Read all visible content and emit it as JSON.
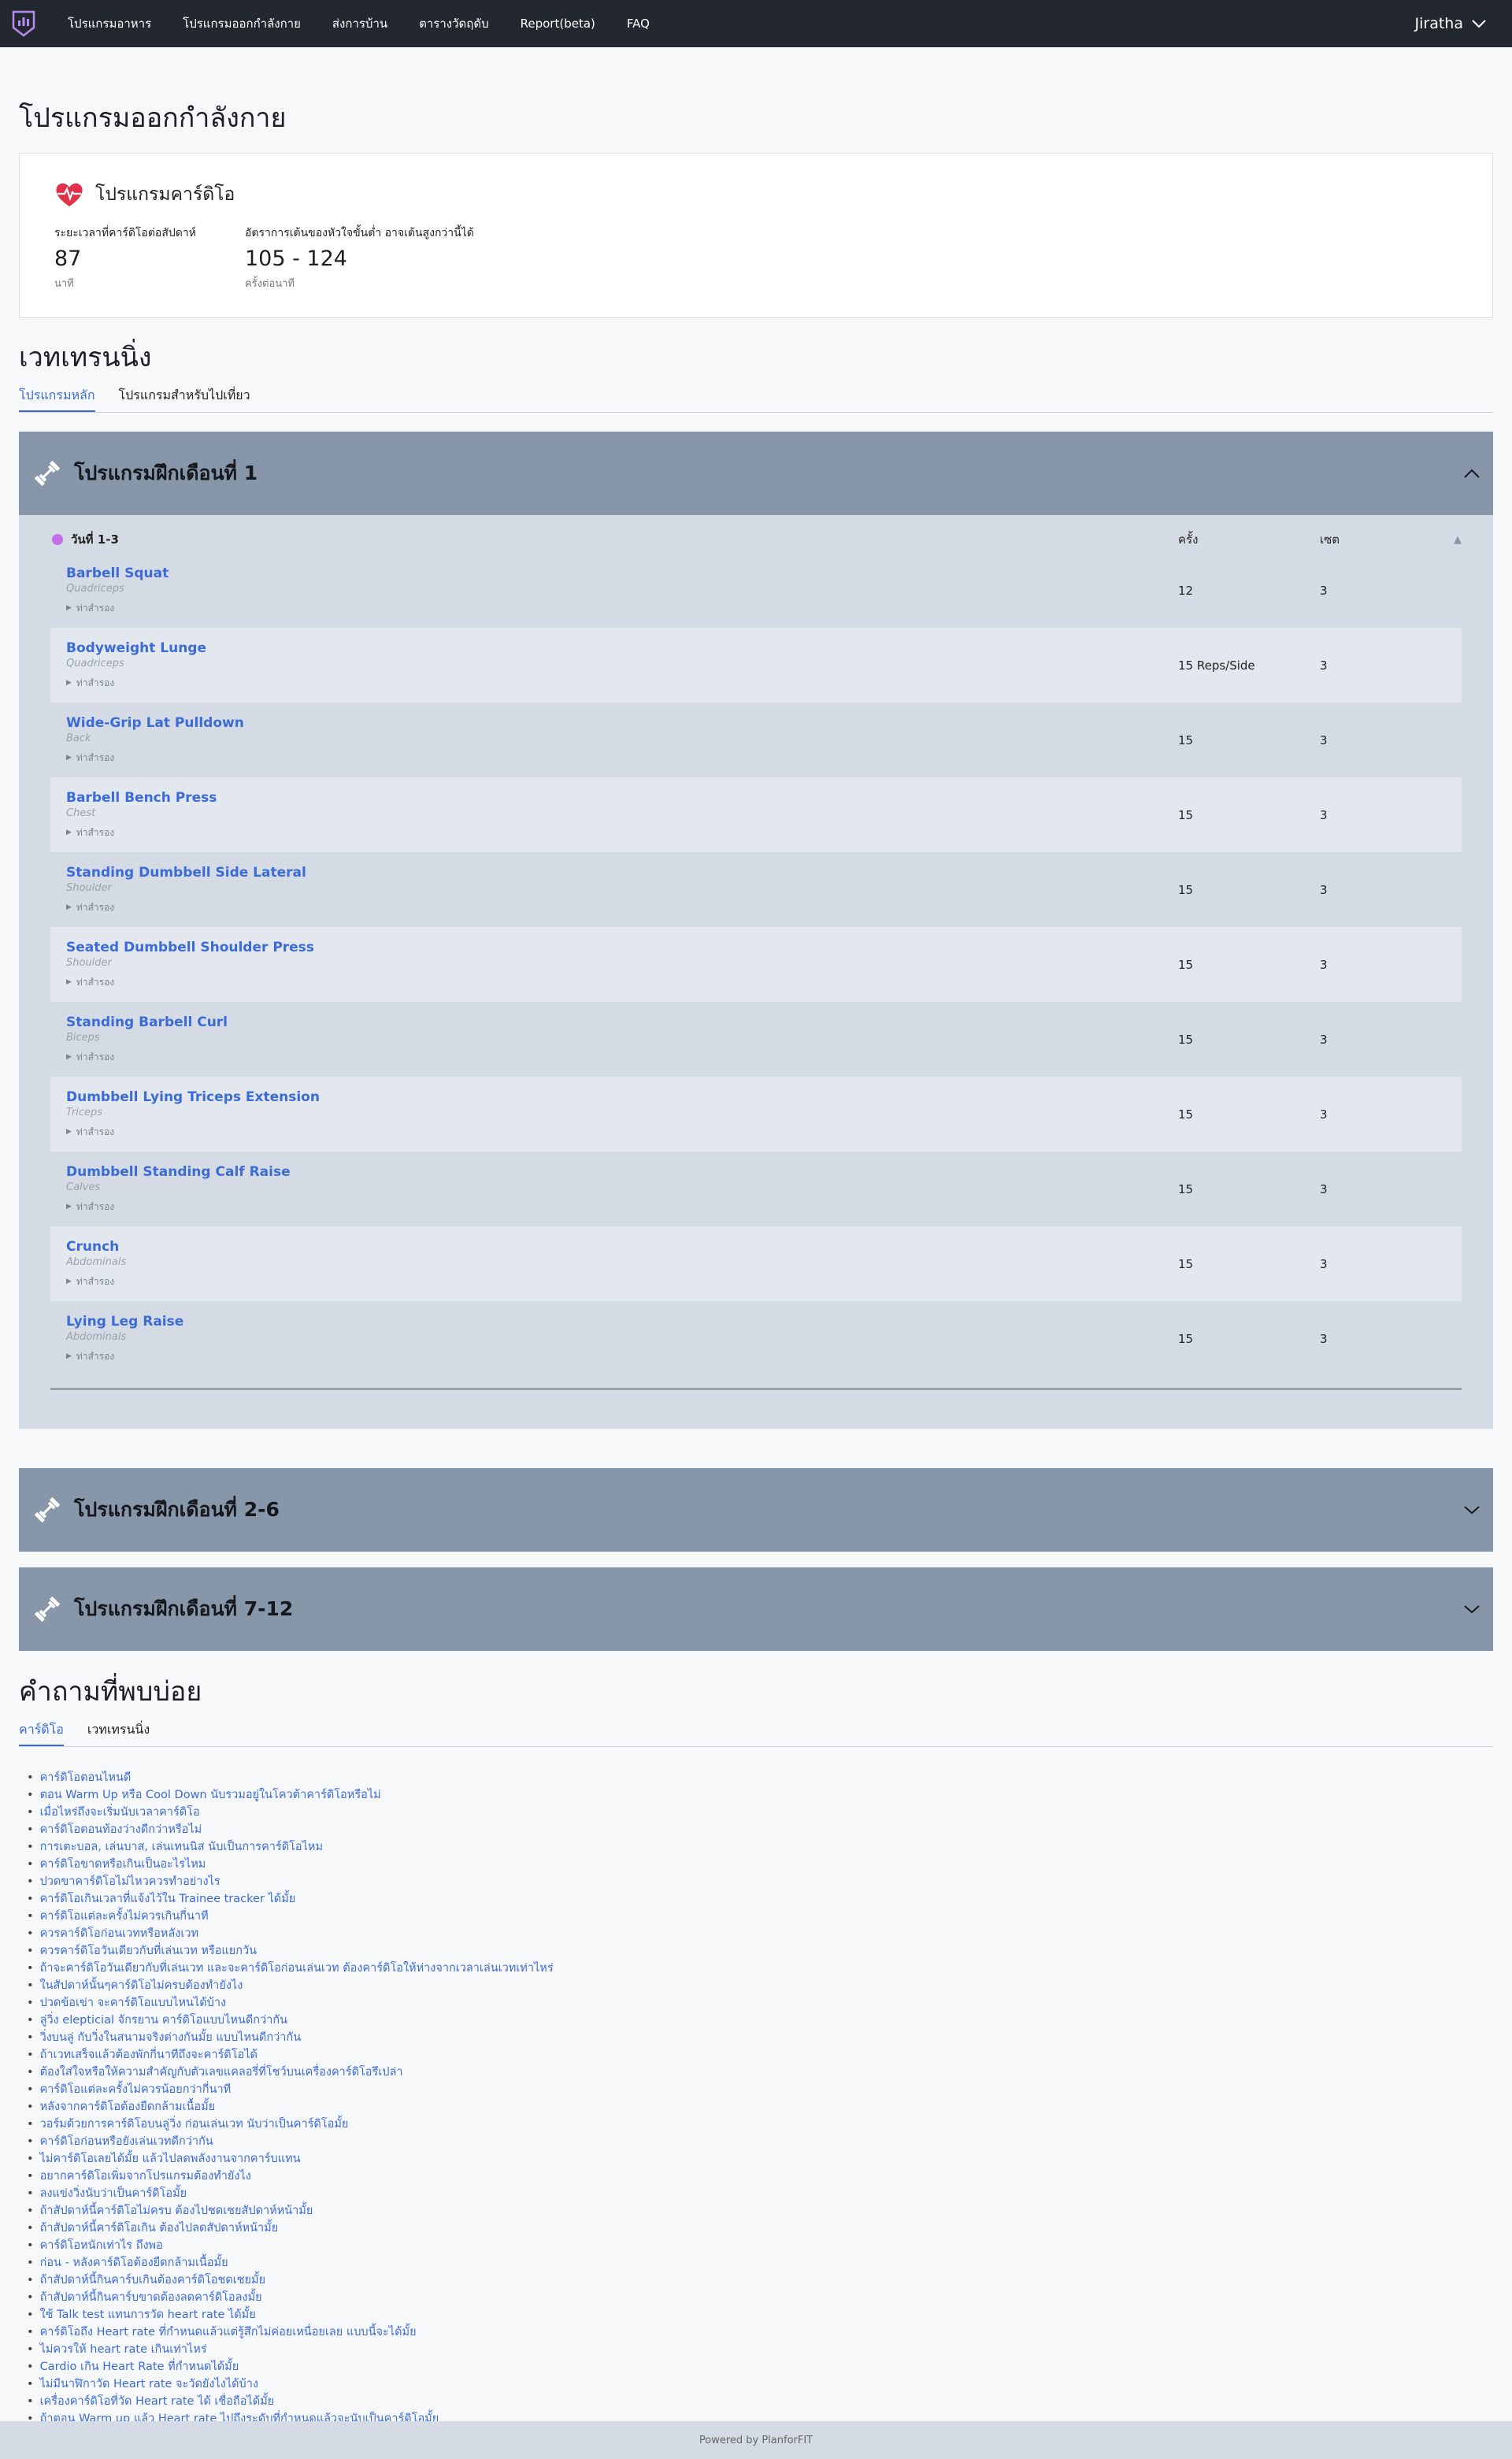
{
  "nav": {
    "links": [
      "โปรแกรมอาหาร",
      "โปรแกรมออกกำลังกาย",
      "ส่งการบ้าน",
      "ตารางวัดฤดับ",
      "Report(beta)",
      "FAQ"
    ],
    "user": "Jiratha"
  },
  "page": {
    "title": "โปรแกรมออกกำลังกาย"
  },
  "cardio": {
    "title": "โปรแกรมคาร์ดิโอ",
    "stat1_label": "ระยะเวลาที่คาร์ดิโอต่อสัปดาห์",
    "stat1_value": "87",
    "stat1_unit": "นาที",
    "stat2_label": "อัตราการเต้นของหัวใจขั้นต่ำ อาจเต้นสูงกว่านี้ได้",
    "stat2_value": "105 - 124",
    "stat2_unit": "ครั้งต่อนาที"
  },
  "weight": {
    "title": "เวทเทรนนิ่ง",
    "tabs": [
      "โปรแกรมหลัก",
      "โปรแกรมสำหรับไปเที่ยว"
    ],
    "month1_title": "โปรแกรมฝึกเดือนที่ 1",
    "day_label": "วันที่ 1-3",
    "col_reps": "ครั้ง",
    "col_sets": "เซต",
    "alt_label": "ท่าสำรอง",
    "exercises": [
      {
        "name": "Barbell Squat",
        "muscle": "Quadriceps",
        "reps": "12",
        "sets": "3"
      },
      {
        "name": "Bodyweight Lunge",
        "muscle": "Quadriceps",
        "reps": "15 Reps/Side",
        "sets": "3"
      },
      {
        "name": "Wide-Grip Lat Pulldown",
        "muscle": "Back",
        "reps": "15",
        "sets": "3"
      },
      {
        "name": "Barbell Bench Press",
        "muscle": "Chest",
        "reps": "15",
        "sets": "3"
      },
      {
        "name": "Standing Dumbbell Side Lateral",
        "muscle": "Shoulder",
        "reps": "15",
        "sets": "3"
      },
      {
        "name": "Seated Dumbbell Shoulder Press",
        "muscle": "Shoulder",
        "reps": "15",
        "sets": "3"
      },
      {
        "name": "Standing Barbell Curl",
        "muscle": "Biceps",
        "reps": "15",
        "sets": "3"
      },
      {
        "name": "Dumbbell Lying Triceps Extension",
        "muscle": "Triceps",
        "reps": "15",
        "sets": "3"
      },
      {
        "name": "Dumbbell Standing Calf Raise",
        "muscle": "Calves",
        "reps": "15",
        "sets": "3"
      },
      {
        "name": "Crunch",
        "muscle": "Abdominals",
        "reps": "15",
        "sets": "3"
      },
      {
        "name": "Lying Leg Raise",
        "muscle": "Abdominals",
        "reps": "15",
        "sets": "3"
      }
    ],
    "month26_title": "โปรแกรมฝึกเดือนที่ 2-6",
    "month712_title": "โปรแกรมฝึกเดือนที่ 7-12"
  },
  "faq": {
    "title": "คำถามที่พบบ่อย",
    "tabs": [
      "คาร์ดิโอ",
      "เวทเทรนนิ่ง"
    ],
    "items": [
      "คาร์ดิโอตอนไหนดี",
      "ตอน Warm Up หรือ Cool Down นับรวมอยู่ในโควต้าคาร์ดิโอหรือไม่",
      "เมื่อไหร่ถึงจะเริ่มนับเวลาคาร์ดิโอ",
      "คาร์ดิโอตอนท้องว่างดีกว่าหรือไม่",
      "การเตะบอล, เล่นบาส, เล่นเทนนิส นับเป็นการคาร์ดิโอไหม",
      "คาร์ดิโอขาดหรือเกินเป็นอะไรไหม",
      "ปวดขาคาร์ดิโอไม่ไหวควรทำอย่างไร",
      "คาร์ดิโอเกินเวลาที่แจ้งไว้ใน Trainee tracker ได้มั้ย",
      "คาร์ดิโอแต่ละครั้งไม่ควรเกินกี่นาที",
      "ควรคาร์ดิโอก่อนเวทหรือหลังเวท",
      "ควรคาร์ดิโอวันเดียวกับที่เล่นเวท หรือแยกวัน",
      "ถ้าจะคาร์ดิโอวันเดียวกับที่เล่นเวท และจะคาร์ดิโอก่อนเล่นเวท ต้องคาร์ดิโอให้ห่างจากเวลาเล่นเวทเท่าไหร่",
      "ในสัปดาห์นั้นๆคาร์ดิโอไม่ครบต้องทำยังไง",
      "ปวดข้อเข่า จะคาร์ดิโอแบบไหนได้บ้าง",
      "ลู่วิ่ง elepticial จักรยาน คาร์ดิโอแบบไหนดีกว่ากัน",
      "วิ่งบนลู่ กับวิ่งในสนามจริงต่างกันมั้ย แบบไหนดีกว่ากัน",
      "ถ้าเวทเสร็จแล้วต้องพักกี่นาทีถึงจะคาร์ดิโอได้",
      "ต้องใส่ใจหรือให้ความสำคัญกับตัวเลขแคลอรี่ที่โชว์บนเครื่องคาร์ดิโอรึเปล่า",
      "คาร์ดิโอแต่ละครั้งไม่ควรน้อยกว่ากี่นาที",
      "หลังจากคาร์ดิโอต้องยืดกล้ามเนื้อมั้ย",
      "วอร์มด้วยการคาร์ดิโอบนลู่วิ่ง ก่อนเล่นเวท นับว่าเป็นคาร์ดิโอมั้ย",
      "คาร์ดิโอก่อนหรือยังเล่นเวทดีกว่ากัน",
      "ไม่คาร์ดิโอเลยได้มั้ย แล้วไปลดพลังงานจากคาร์บแทน",
      "อยากคาร์ดิโอเพิ่มจากโปรแกรมต้องทำยังไง",
      "ลงแข่งวิ่งนับว่าเป็นคาร์ดิโอมั้ย",
      "ถ้าสัปดาห์นี้คาร์ดิโอไม่ครบ ต้องไปชดเชยสัปดาห์หน้ามั้ย",
      "ถ้าสัปดาห์นี้คาร์ดิโอเกิน ต้องไปลดสัปดาห์หน้ามั้ย",
      "คาร์ดิโอหนักเท่าไร ถึงพอ",
      "ก่อน - หลังคาร์ดิโอต้องยืดกล้ามเนื้อมั้ย",
      "ถ้าสัปดาห์นี้กินคาร์บเกินต้องคาร์ดิโอชดเชยมั้ย",
      "ถ้าสัปดาห์นี้กินคาร์บขาดต้องลดคาร์ดิโอลงมั้ย",
      "ใช้ Talk test แทนการวัด heart rate ได้มั้ย",
      "คาร์ดิโอถึง Heart rate ที่กำหนดแล้วแต่รู้สึกไม่ค่อยเหนื่อยเลย แบบนี้จะได้มั้ย",
      "ไม่ควรให้ heart rate เกินเท่าไหร่",
      "Cardio เกิน Heart Rate ที่กำหนดได้มั้ย",
      "ไม่มีนาฬิกาวัด Heart rate จะวัดยังไงได้บ้าง",
      "เครื่องคาร์ดิโอที่วัด Heart rate ได้ เชื่อถือได้มั้ย",
      "ถ้าตอน Warm up แล้ว Heart rate ไปถึงระดับที่กำหนดแล้วจะนับเป็นคาร์ดิโอมั้ย"
    ]
  },
  "footer": {
    "text": "Powered by PlanforFIT"
  },
  "colors": {
    "nav_bg": "#232830",
    "accordion_bg": "#8796a8",
    "link": "#3b6bd6",
    "heart": "#e0334a",
    "dot": "#c16ee8"
  }
}
